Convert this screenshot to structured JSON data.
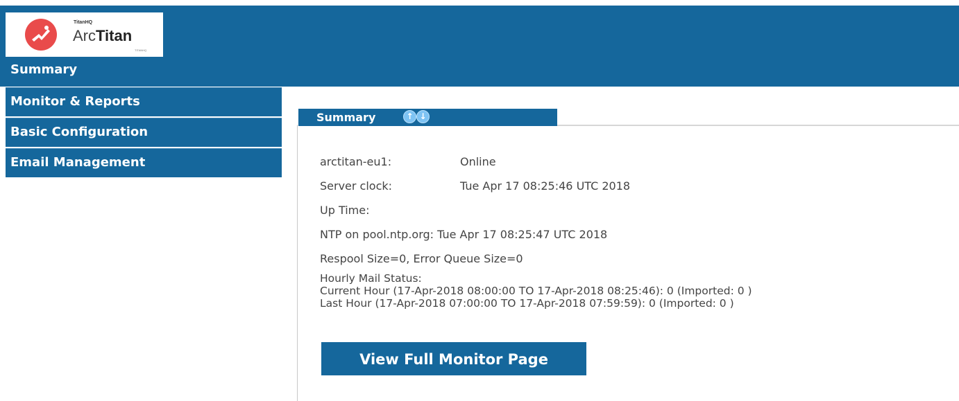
{
  "logo": {
    "brand_small": "TitanHQ",
    "name_light": "Arc",
    "name_bold": "Titan",
    "tagline": "TITANHQ"
  },
  "header": {
    "section_title": "Summary"
  },
  "sidebar": {
    "items": [
      {
        "label": "Monitor & Reports"
      },
      {
        "label": "Basic Configuration"
      },
      {
        "label": "Email Management"
      }
    ]
  },
  "panel": {
    "tab_title": "Summary",
    "up_icon": "arrow-up-icon",
    "down_icon": "arrow-down-icon"
  },
  "status": {
    "host_label": "arctitan-eu1:",
    "host_value": "Online",
    "clock_label": "Server clock:",
    "clock_value": "Tue Apr 17 08:25:46 UTC 2018",
    "uptime_label": "Up Time:",
    "uptime_value": "",
    "ntp_line": "NTP on pool.ntp.org: Tue Apr 17 08:25:47 UTC 2018",
    "spool_line": "Respool Size=0, Error Queue Size=0",
    "hourly_title": "Hourly Mail Status:",
    "current_hour": "Current Hour (17-Apr-2018 08:00:00 TO 17-Apr-2018 08:25:46): 0 (Imported: 0 )",
    "last_hour": "Last Hour (17-Apr-2018 07:00:00 TO 17-Apr-2018 07:59:59): 0 (Imported: 0 )"
  },
  "actions": {
    "view_monitor_label": "View Full Monitor Page"
  },
  "colors": {
    "primary": "#15679c",
    "logo_red": "#e94b4b",
    "arrow_blue": "#7ec3f3",
    "text": "#444444"
  }
}
